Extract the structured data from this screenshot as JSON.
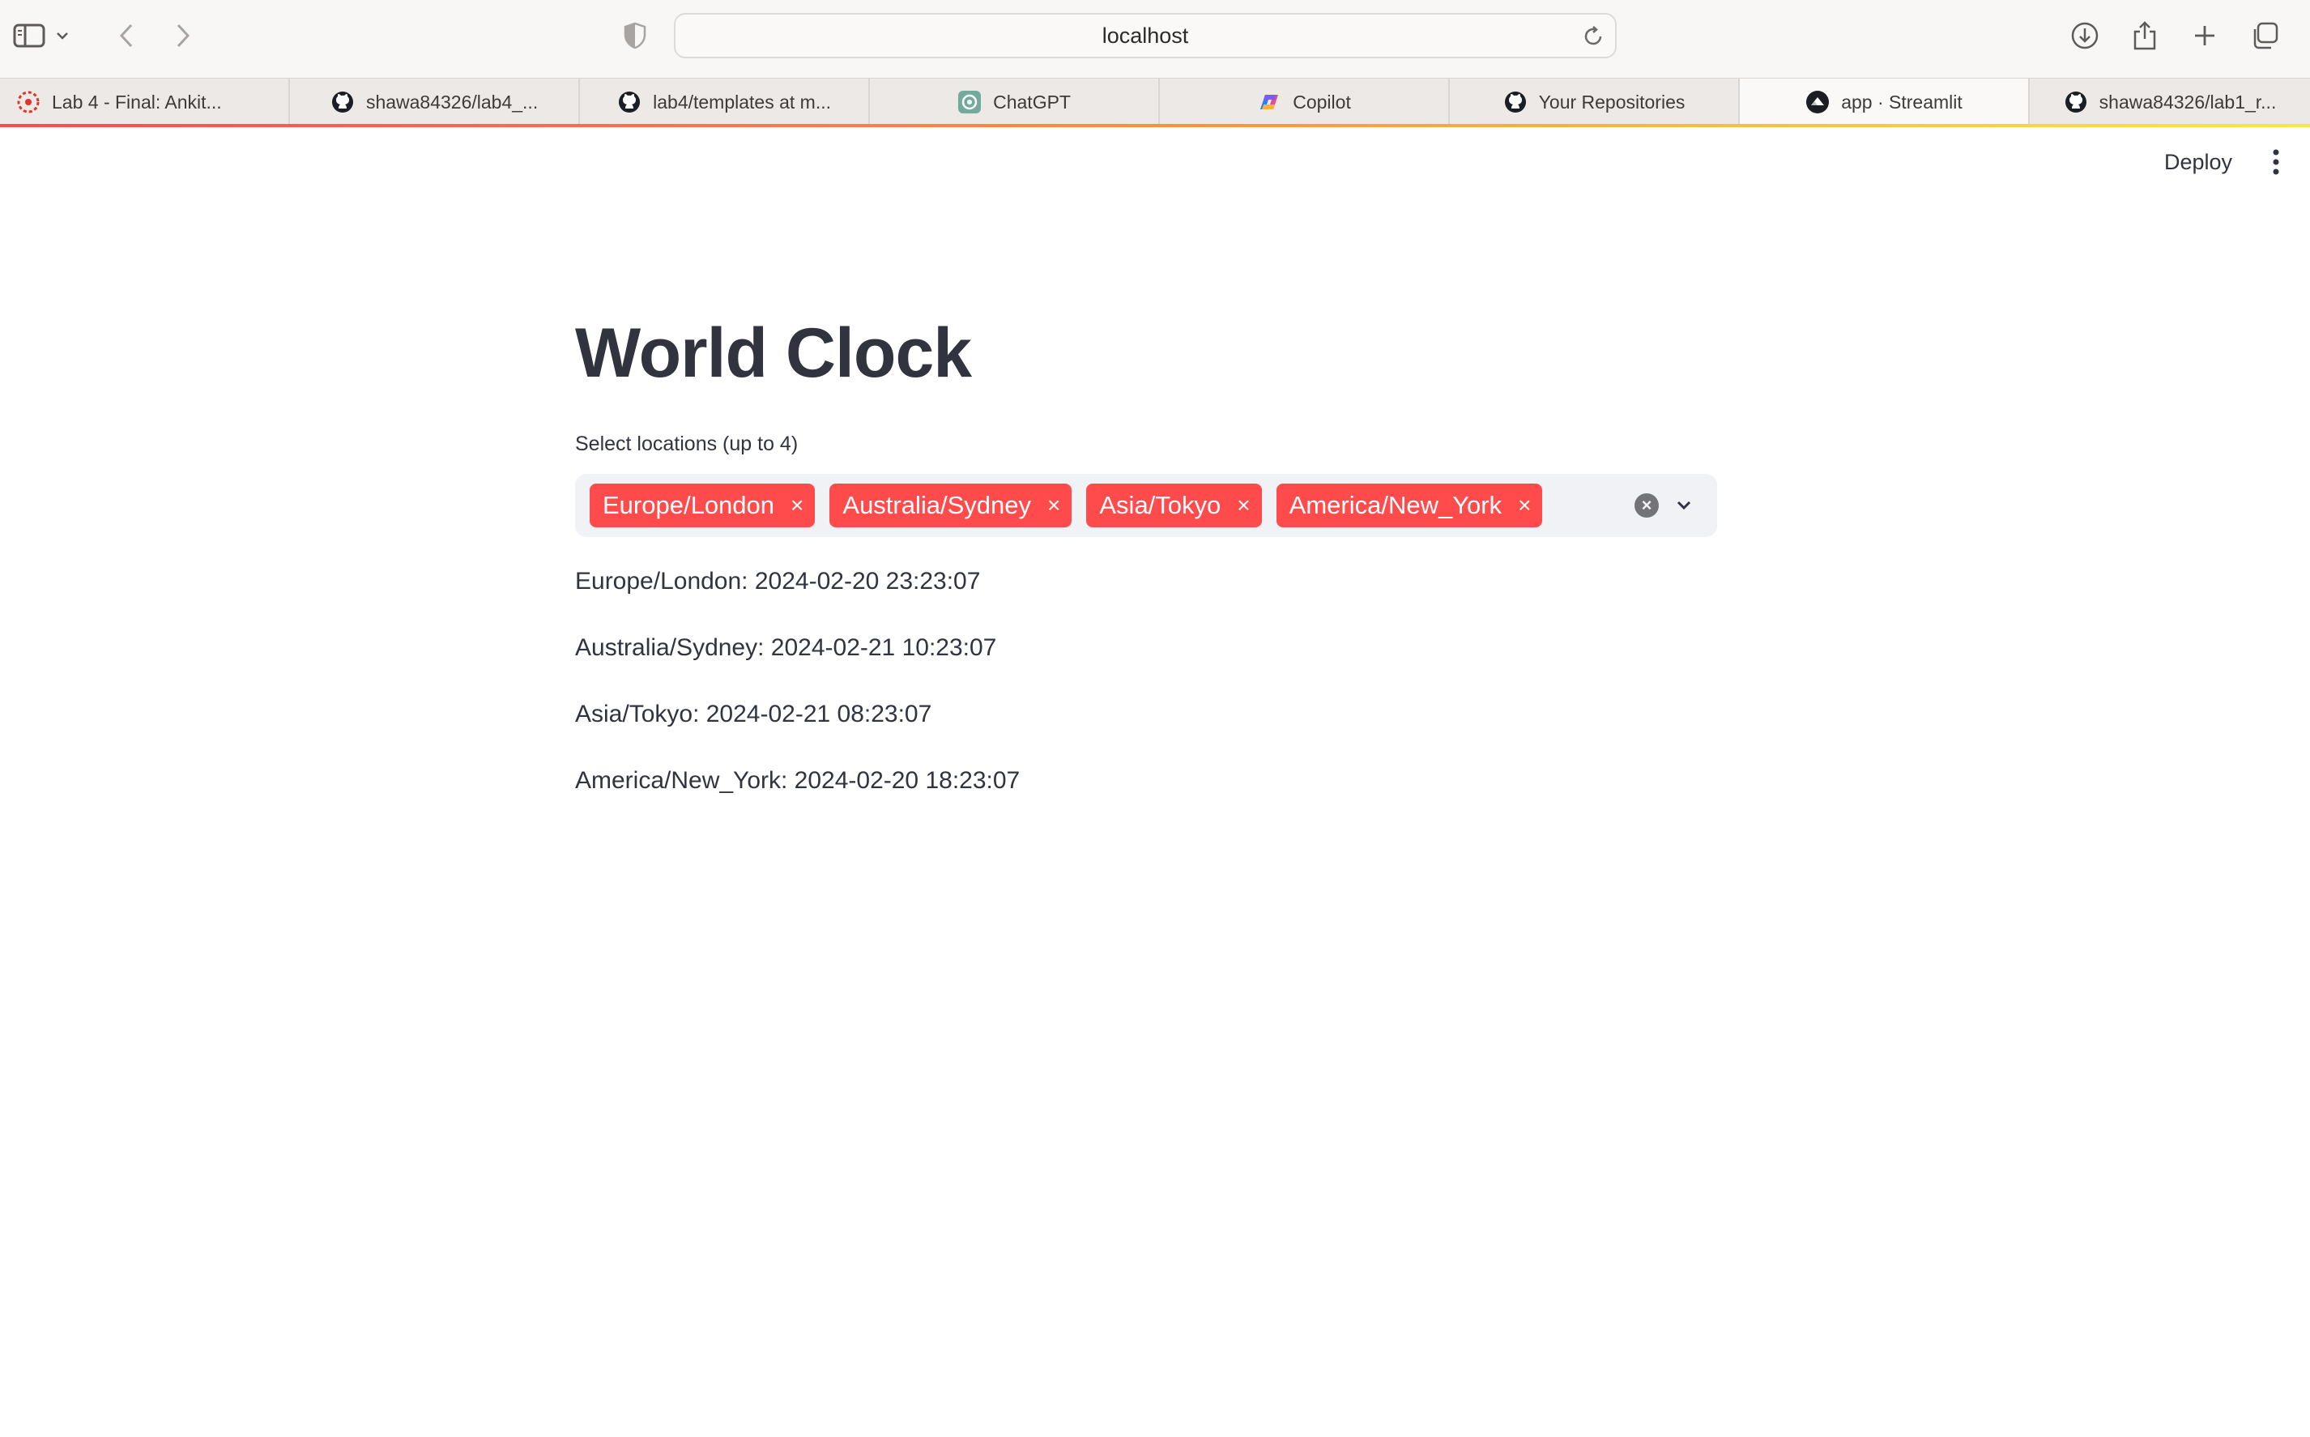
{
  "browser": {
    "address": "localhost",
    "tabs": [
      {
        "label": "Lab 4 - Final: Ankit...",
        "icon": "canvas-icon",
        "active": false
      },
      {
        "label": "shawa84326/lab4_...",
        "icon": "github-icon",
        "active": false
      },
      {
        "label": "lab4/templates at m...",
        "icon": "github-icon",
        "active": false
      },
      {
        "label": "ChatGPT",
        "icon": "chatgpt-icon",
        "active": false
      },
      {
        "label": "Copilot",
        "icon": "copilot-icon",
        "active": false
      },
      {
        "label": "Your Repositories",
        "icon": "github-icon",
        "active": false
      },
      {
        "label": "app · Streamlit",
        "icon": "streamlit-icon",
        "active": true
      },
      {
        "label": "shawa84326/lab1_r...",
        "icon": "github-icon",
        "active": false
      }
    ]
  },
  "header": {
    "deploy_label": "Deploy"
  },
  "main": {
    "title": "World Clock",
    "select_label": "Select locations (up to 4)",
    "selected": [
      "Europe/London",
      "Australia/Sydney",
      "Asia/Tokyo",
      "America/New_York"
    ],
    "times": [
      "Europe/London: 2024-02-20 23:23:07",
      "Australia/Sydney: 2024-02-21 10:23:07",
      "Asia/Tokyo: 2024-02-21 08:23:07",
      "America/New_York: 2024-02-20 18:23:07"
    ]
  },
  "colors": {
    "accent": "#ff4b4b",
    "text": "#31333f",
    "input_bg": "#f0f2f6"
  }
}
